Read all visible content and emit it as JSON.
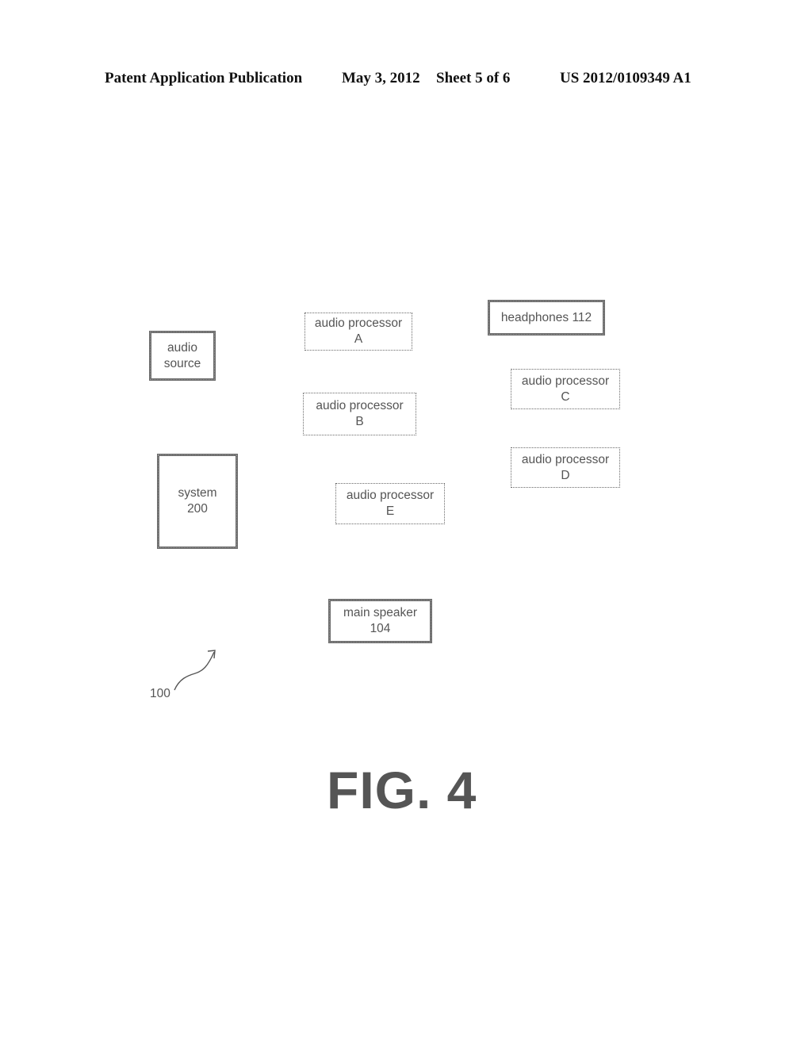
{
  "header": {
    "publication": "Patent Application Publication",
    "date": "May 3, 2012",
    "sheet": "Sheet 5 of 6",
    "number": "US 2012/0109349 A1"
  },
  "diagram": {
    "blocks": {
      "audio_source": {
        "line1": "audio",
        "line2": "source"
      },
      "processor_a": {
        "line1": "audio processor",
        "line2": "A"
      },
      "processor_b": {
        "line1": "audio processor",
        "line2": "B"
      },
      "processor_c": {
        "line1": "audio processor",
        "line2": "C"
      },
      "processor_d": {
        "line1": "audio processor",
        "line2": "D"
      },
      "processor_e": {
        "line1": "audio processor",
        "line2": "E"
      },
      "headphones": {
        "line1": "headphones 112"
      },
      "system": {
        "line1": "system",
        "line2": "200"
      },
      "main_speaker": {
        "line1": "main speaker",
        "line2": "104"
      }
    },
    "reference_label": "100",
    "figure_label": "FIG. 4"
  }
}
